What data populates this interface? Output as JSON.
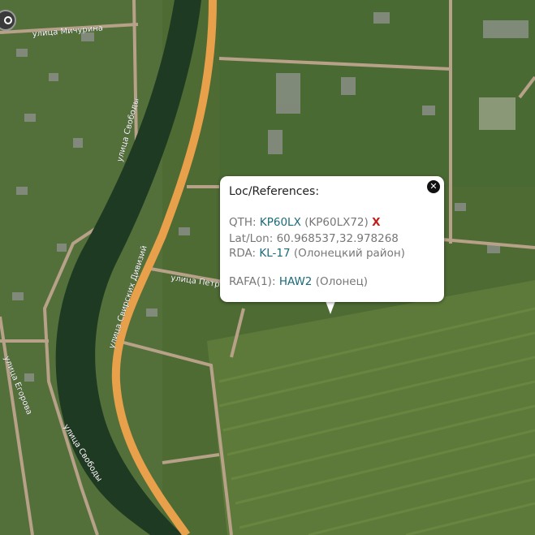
{
  "map": {
    "streets": [
      "улица Мичурина",
      "улица Свободы",
      "улица Свирских Дивизий",
      "улица Петр",
      "улица Егорова",
      "улица Свободы"
    ]
  },
  "popup": {
    "title": "Loc/References:",
    "close_symbol": "✕",
    "qth_label": "QTH:",
    "qth_locator": "KP60LX",
    "qth_extended": "(KP60LX72)",
    "qth_remove": "X",
    "latlon_label": "Lat/Lon:",
    "latlon_value": "60.968537,32.978268",
    "rda_label": "RDA:",
    "rda_code": "KL-17",
    "rda_name": "(Олонецкий район)",
    "rafa_label": "RAFA(1):",
    "rafa_code": "HAW2",
    "rafa_name": "(Олонец)"
  },
  "colors": {
    "link": "#1a6a78",
    "remove": "#c0211b",
    "river": "#1f3a22",
    "main_road": "#e8a04a"
  },
  "icons": {
    "nav": "navigation-icon",
    "close": "close-icon"
  }
}
